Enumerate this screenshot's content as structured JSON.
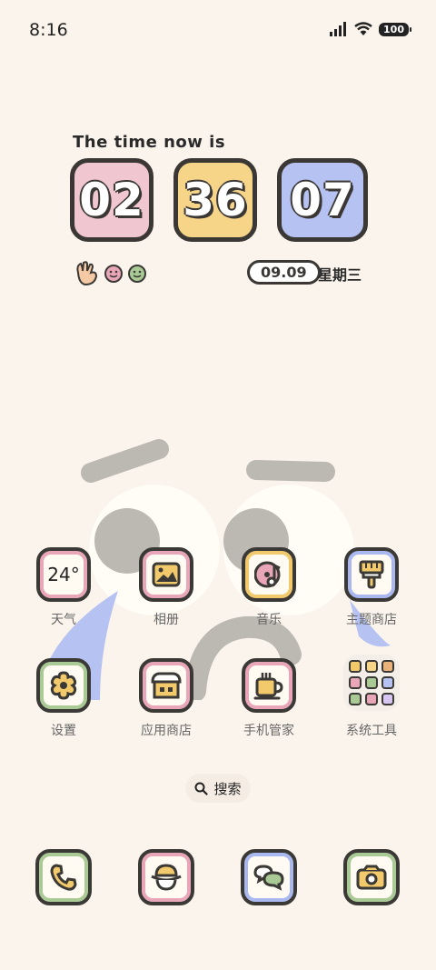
{
  "status_bar": {
    "time": "8:16",
    "battery": "100"
  },
  "widget": {
    "caption": "The time now is",
    "hours": "02",
    "minutes": "36",
    "seconds": "07",
    "date": "09.09",
    "weekday": "星期三",
    "colors": {
      "hours": "#f0c7d1",
      "minutes": "#f6d488",
      "seconds": "#b6c3f2"
    },
    "emoji_icons": [
      "ok-hand-icon",
      "smile-pink-icon",
      "smile-green-icon"
    ]
  },
  "apps_row1": [
    {
      "label": "天气",
      "icon": "weather-icon",
      "value": "24°"
    },
    {
      "label": "相册",
      "icon": "gallery-icon"
    },
    {
      "label": "音乐",
      "icon": "music-icon"
    },
    {
      "label": "主题商店",
      "icon": "themes-icon"
    }
  ],
  "apps_row2": [
    {
      "label": "设置",
      "icon": "settings-icon"
    },
    {
      "label": "应用商店",
      "icon": "app-store-icon"
    },
    {
      "label": "手机管家",
      "icon": "security-icon"
    },
    {
      "label": "系统工具",
      "icon": "folder-icon"
    }
  ],
  "search": {
    "label": "搜索"
  },
  "dock": [
    {
      "icon": "phone-icon"
    },
    {
      "icon": "browser-icon"
    },
    {
      "icon": "messages-icon"
    },
    {
      "icon": "camera-icon"
    }
  ]
}
